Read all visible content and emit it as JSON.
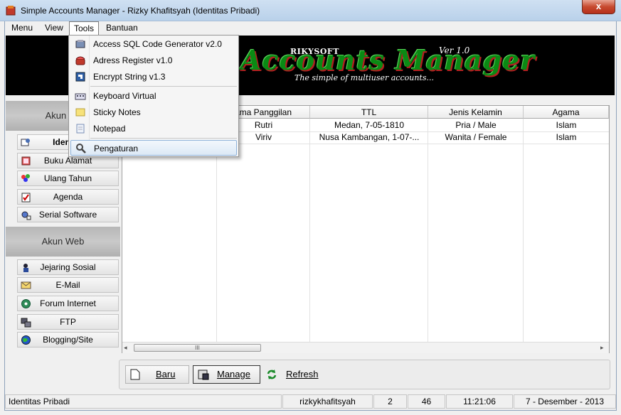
{
  "window": {
    "title": "Simple Accounts Manager - Rizky Khafitsyah (Identitas Pribadi)",
    "close_label": "x"
  },
  "menubar": {
    "items": [
      {
        "label": "Menu"
      },
      {
        "label": "View"
      },
      {
        "label": "Tools"
      },
      {
        "label": "Bantuan"
      }
    ]
  },
  "tools_menu": {
    "items": [
      {
        "label": "Access SQL Code Generator v2.0",
        "icon": "database-icon"
      },
      {
        "label": "Adress Register v1.0",
        "icon": "phone-icon"
      },
      {
        "label": "Encrypt String v1.3",
        "icon": "encrypt-icon"
      },
      {
        "label": "Keyboard Virtual",
        "icon": "keyboard-icon"
      },
      {
        "label": "Sticky Notes",
        "icon": "sticky-note-icon"
      },
      {
        "label": "Notepad",
        "icon": "notepad-icon"
      },
      {
        "label": "Pengaturan",
        "icon": "settings-wrench-icon"
      }
    ]
  },
  "banner": {
    "brand": "RIKYSOFT",
    "title": "Accounts Manager",
    "version": "Ver 1.0",
    "subtitle": "The simple of multiuser accounts..."
  },
  "sidebar": {
    "section1": "Akun De",
    "section1_items": [
      {
        "label": "Identita",
        "icon": "identity-icon"
      },
      {
        "label": "Buku Alamat",
        "icon": "address-book-icon"
      },
      {
        "label": "Ulang Tahun",
        "icon": "birthday-icon"
      },
      {
        "label": "Agenda",
        "icon": "agenda-icon"
      },
      {
        "label": "Serial Software",
        "icon": "serial-icon"
      }
    ],
    "section2": "Akun Web",
    "section2_items": [
      {
        "label": "Jejaring Sosial",
        "icon": "social-icon"
      },
      {
        "label": "E-Mail",
        "icon": "email-icon"
      },
      {
        "label": "Forum Internet",
        "icon": "forum-icon"
      },
      {
        "label": "FTP",
        "icon": "ftp-icon"
      },
      {
        "label": "Blogging/Site",
        "icon": "globe-icon"
      }
    ]
  },
  "grid": {
    "columns": [
      "ama Panggilan",
      "TTL",
      "Jenis Kelamin",
      "Agama"
    ],
    "rows": [
      [
        "Rutri",
        "Medan, 7-05-1810",
        "Pria / Male",
        "Islam"
      ],
      [
        "Viriv",
        "Nusa Kambangan, 1-07-...",
        "Wanita / Female",
        "Islam"
      ]
    ],
    "scroll_thumb": "III"
  },
  "buttons": {
    "baru": "Baru",
    "manage": "Manage",
    "refresh": "Refresh"
  },
  "status": {
    "section": "Identitas Pribadi",
    "user": "rizkykhafitsyah",
    "num1": "2",
    "num2": "46",
    "time": "11:21:06",
    "date": "7 - Desember - 2013"
  }
}
